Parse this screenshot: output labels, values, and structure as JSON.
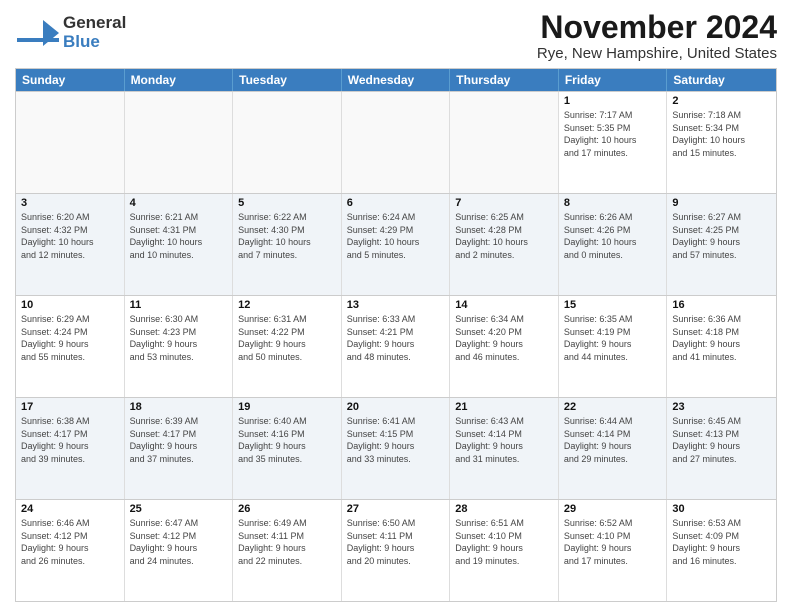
{
  "header": {
    "logo_general": "General",
    "logo_blue": "Blue",
    "title": "November 2024",
    "subtitle": "Rye, New Hampshire, United States"
  },
  "calendar": {
    "days_of_week": [
      "Sunday",
      "Monday",
      "Tuesday",
      "Wednesday",
      "Thursday",
      "Friday",
      "Saturday"
    ],
    "weeks": [
      [
        {
          "day": "",
          "info": ""
        },
        {
          "day": "",
          "info": ""
        },
        {
          "day": "",
          "info": ""
        },
        {
          "day": "",
          "info": ""
        },
        {
          "day": "",
          "info": ""
        },
        {
          "day": "1",
          "info": "Sunrise: 7:17 AM\nSunset: 5:35 PM\nDaylight: 10 hours\nand 17 minutes."
        },
        {
          "day": "2",
          "info": "Sunrise: 7:18 AM\nSunset: 5:34 PM\nDaylight: 10 hours\nand 15 minutes."
        }
      ],
      [
        {
          "day": "3",
          "info": "Sunrise: 6:20 AM\nSunset: 4:32 PM\nDaylight: 10 hours\nand 12 minutes."
        },
        {
          "day": "4",
          "info": "Sunrise: 6:21 AM\nSunset: 4:31 PM\nDaylight: 10 hours\nand 10 minutes."
        },
        {
          "day": "5",
          "info": "Sunrise: 6:22 AM\nSunset: 4:30 PM\nDaylight: 10 hours\nand 7 minutes."
        },
        {
          "day": "6",
          "info": "Sunrise: 6:24 AM\nSunset: 4:29 PM\nDaylight: 10 hours\nand 5 minutes."
        },
        {
          "day": "7",
          "info": "Sunrise: 6:25 AM\nSunset: 4:28 PM\nDaylight: 10 hours\nand 2 minutes."
        },
        {
          "day": "8",
          "info": "Sunrise: 6:26 AM\nSunset: 4:26 PM\nDaylight: 10 hours\nand 0 minutes."
        },
        {
          "day": "9",
          "info": "Sunrise: 6:27 AM\nSunset: 4:25 PM\nDaylight: 9 hours\nand 57 minutes."
        }
      ],
      [
        {
          "day": "10",
          "info": "Sunrise: 6:29 AM\nSunset: 4:24 PM\nDaylight: 9 hours\nand 55 minutes."
        },
        {
          "day": "11",
          "info": "Sunrise: 6:30 AM\nSunset: 4:23 PM\nDaylight: 9 hours\nand 53 minutes."
        },
        {
          "day": "12",
          "info": "Sunrise: 6:31 AM\nSunset: 4:22 PM\nDaylight: 9 hours\nand 50 minutes."
        },
        {
          "day": "13",
          "info": "Sunrise: 6:33 AM\nSunset: 4:21 PM\nDaylight: 9 hours\nand 48 minutes."
        },
        {
          "day": "14",
          "info": "Sunrise: 6:34 AM\nSunset: 4:20 PM\nDaylight: 9 hours\nand 46 minutes."
        },
        {
          "day": "15",
          "info": "Sunrise: 6:35 AM\nSunset: 4:19 PM\nDaylight: 9 hours\nand 44 minutes."
        },
        {
          "day": "16",
          "info": "Sunrise: 6:36 AM\nSunset: 4:18 PM\nDaylight: 9 hours\nand 41 minutes."
        }
      ],
      [
        {
          "day": "17",
          "info": "Sunrise: 6:38 AM\nSunset: 4:17 PM\nDaylight: 9 hours\nand 39 minutes."
        },
        {
          "day": "18",
          "info": "Sunrise: 6:39 AM\nSunset: 4:17 PM\nDaylight: 9 hours\nand 37 minutes."
        },
        {
          "day": "19",
          "info": "Sunrise: 6:40 AM\nSunset: 4:16 PM\nDaylight: 9 hours\nand 35 minutes."
        },
        {
          "day": "20",
          "info": "Sunrise: 6:41 AM\nSunset: 4:15 PM\nDaylight: 9 hours\nand 33 minutes."
        },
        {
          "day": "21",
          "info": "Sunrise: 6:43 AM\nSunset: 4:14 PM\nDaylight: 9 hours\nand 31 minutes."
        },
        {
          "day": "22",
          "info": "Sunrise: 6:44 AM\nSunset: 4:14 PM\nDaylight: 9 hours\nand 29 minutes."
        },
        {
          "day": "23",
          "info": "Sunrise: 6:45 AM\nSunset: 4:13 PM\nDaylight: 9 hours\nand 27 minutes."
        }
      ],
      [
        {
          "day": "24",
          "info": "Sunrise: 6:46 AM\nSunset: 4:12 PM\nDaylight: 9 hours\nand 26 minutes."
        },
        {
          "day": "25",
          "info": "Sunrise: 6:47 AM\nSunset: 4:12 PM\nDaylight: 9 hours\nand 24 minutes."
        },
        {
          "day": "26",
          "info": "Sunrise: 6:49 AM\nSunset: 4:11 PM\nDaylight: 9 hours\nand 22 minutes."
        },
        {
          "day": "27",
          "info": "Sunrise: 6:50 AM\nSunset: 4:11 PM\nDaylight: 9 hours\nand 20 minutes."
        },
        {
          "day": "28",
          "info": "Sunrise: 6:51 AM\nSunset: 4:10 PM\nDaylight: 9 hours\nand 19 minutes."
        },
        {
          "day": "29",
          "info": "Sunrise: 6:52 AM\nSunset: 4:10 PM\nDaylight: 9 hours\nand 17 minutes."
        },
        {
          "day": "30",
          "info": "Sunrise: 6:53 AM\nSunset: 4:09 PM\nDaylight: 9 hours\nand 16 minutes."
        }
      ]
    ]
  }
}
